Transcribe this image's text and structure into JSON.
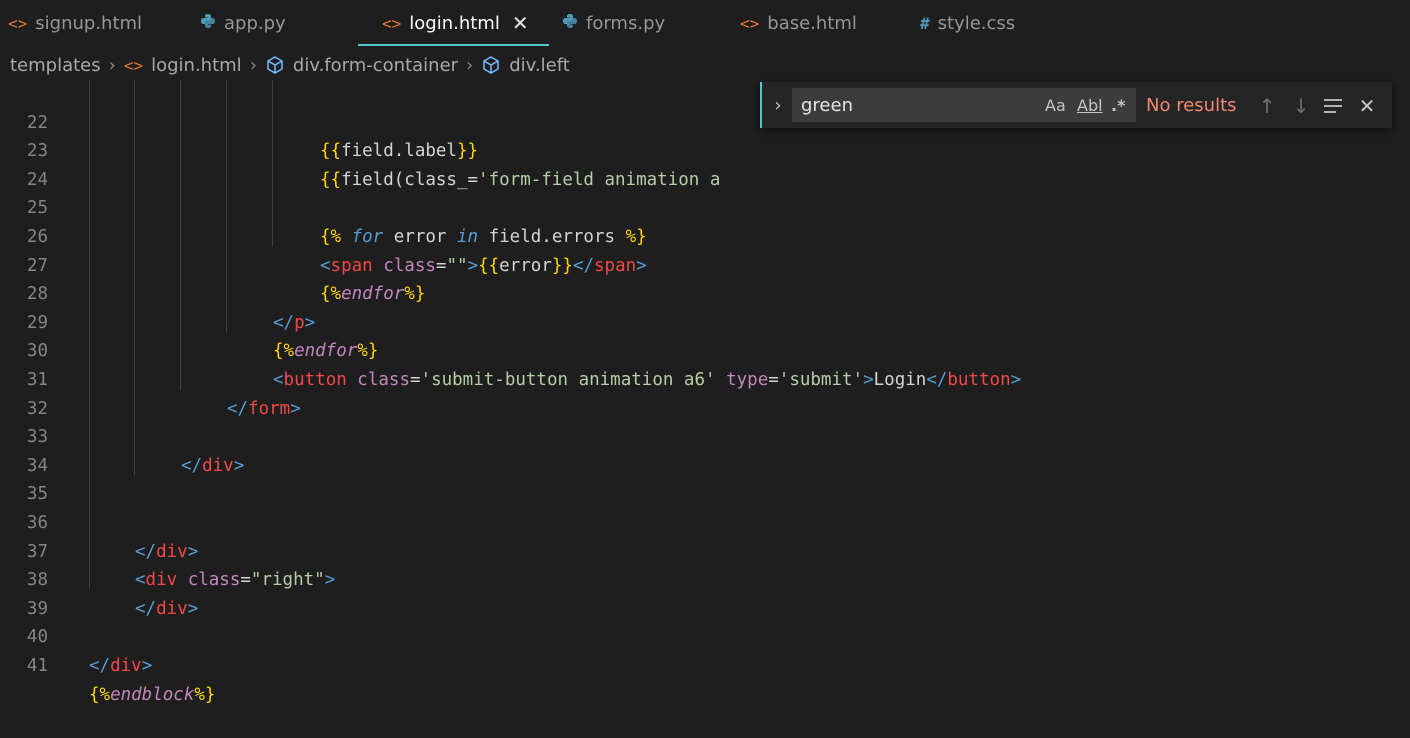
{
  "tabs": [
    {
      "label": "signup.html",
      "icon": "html-icon"
    },
    {
      "label": "app.py",
      "icon": "python-icon"
    },
    {
      "label": "login.html",
      "icon": "html-icon",
      "active": true
    },
    {
      "label": "forms.py",
      "icon": "python-icon"
    },
    {
      "label": "base.html",
      "icon": "html-icon"
    },
    {
      "label": "style.css",
      "icon": "css-icon"
    }
  ],
  "breadcrumb": [
    "templates",
    "login.html",
    "div.form-container",
    "div.left"
  ],
  "find": {
    "query": "green",
    "status": "No results",
    "options": {
      "match_case": "Aa",
      "whole_word": "Abl",
      "regex": ".*"
    }
  },
  "lines": [
    {
      "n": "22"
    },
    {
      "n": "23"
    },
    {
      "n": "24"
    },
    {
      "n": "25"
    },
    {
      "n": "26"
    },
    {
      "n": "27"
    },
    {
      "n": "28"
    },
    {
      "n": "29"
    },
    {
      "n": "30"
    },
    {
      "n": "31"
    },
    {
      "n": "32"
    },
    {
      "n": "33"
    },
    {
      "n": "34"
    },
    {
      "n": "35"
    },
    {
      "n": "36"
    },
    {
      "n": "37"
    },
    {
      "n": "38"
    },
    {
      "n": "39"
    },
    {
      "n": "40"
    },
    {
      "n": "41"
    }
  ],
  "code": {
    "l22_a": "{{",
    "l22_b": "field.label",
    "l22_c": "}}",
    "l23_a": "{{",
    "l23_b": "field(class_=",
    "l23_c": "'form-field animation a",
    "l25_a": "{%",
    "l25_b": " for",
    "l25_c": " error ",
    "l25_d": "in",
    "l25_e": " field.errors ",
    "l25_f": "%}",
    "l26_a": "<",
    "l26_b": "span",
    "l26_c": " class",
    "l26_d": "=",
    "l26_e": "\"\"",
    "l26_f": ">",
    "l26_g": "{{",
    "l26_h": "error",
    "l26_i": "}}",
    "l26_j": "</",
    "l26_k": "span",
    "l26_l": ">",
    "l27_a": "{%",
    "l27_b": "endfor",
    "l27_c": "%}",
    "l28_a": "</",
    "l28_b": "p",
    "l28_c": ">",
    "l29_a": "{%",
    "l29_b": "endfor",
    "l29_c": "%}",
    "l30_a": "<",
    "l30_b": "button",
    "l30_c": " class",
    "l30_d": "=",
    "l30_e": "'submit-button animation a6'",
    "l30_f": " type",
    "l30_g": "=",
    "l30_h": "'submit'",
    "l30_i": ">",
    "l30_j": "Login",
    "l30_k": "</",
    "l30_l": "button",
    "l30_m": ">",
    "l31_a": "</",
    "l31_b": "form",
    "l31_c": ">",
    "l33_a": "</",
    "l33_b": "div",
    "l33_c": ">",
    "l36_a": "</",
    "l36_b": "div",
    "l36_c": ">",
    "l37_a": "<",
    "l37_b": "div",
    "l37_c": " class",
    "l37_d": "=",
    "l37_e": "\"right\"",
    "l37_f": ">",
    "l38_a": "</",
    "l38_b": "div",
    "l38_c": ">",
    "l40_a": "</",
    "l40_b": "div",
    "l40_c": ">",
    "l41_a": "{%",
    "l41_b": "endblock",
    "l41_c": "%}"
  }
}
